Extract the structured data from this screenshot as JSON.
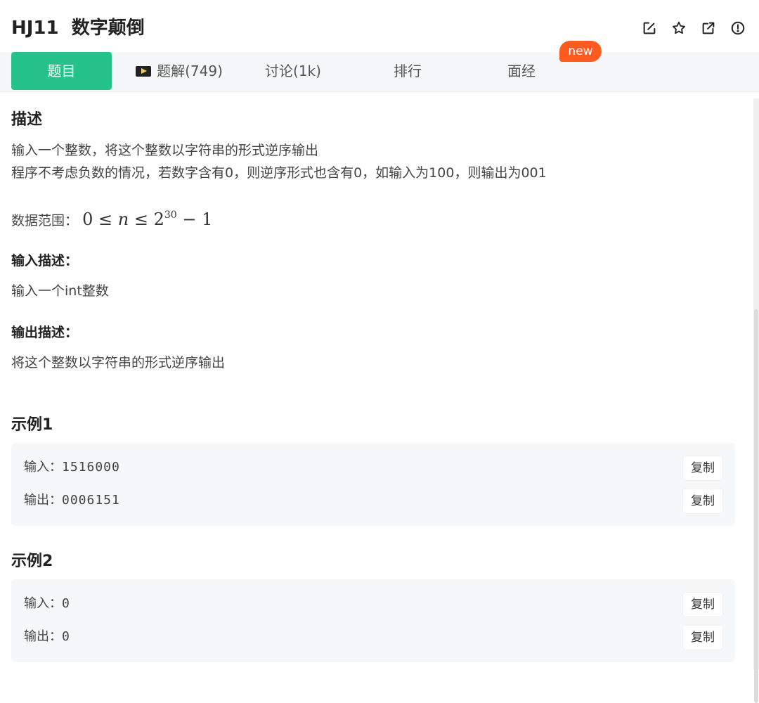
{
  "header": {
    "title": "HJ11  数字颠倒",
    "icons": [
      "edit-icon",
      "star-icon",
      "external-link-icon",
      "alert-icon"
    ]
  },
  "tabs": [
    {
      "label": "题目",
      "active": true
    },
    {
      "label": "题解(749)",
      "icon": "video-icon"
    },
    {
      "label": "讨论(1k)"
    },
    {
      "label": "排行"
    },
    {
      "label": "面经"
    }
  ],
  "badge_new": "new",
  "description": {
    "heading": "描述",
    "line1": "输入一个整数，将这个整数以字符串的形式逆序输出",
    "line2": "程序不考虑负数的情况，若数字含有0，则逆序形式也含有0，如输入为100，则输出为001",
    "range_label": "数据范围：",
    "range_lo": "0",
    "range_leq1": "≤",
    "range_var": "n",
    "range_leq2": "≤",
    "range_base": "2",
    "range_exp": "30",
    "range_minus": "−",
    "range_one": "1"
  },
  "input_desc": {
    "heading": "输入描述：",
    "text": "输入一个int整数"
  },
  "output_desc": {
    "heading": "输出描述：",
    "text": "将这个整数以字符串的形式逆序输出"
  },
  "examples": [
    {
      "heading": "示例1",
      "input_label": "输入：",
      "input": "1516000",
      "output_label": "输出：",
      "output": "0006151",
      "copy": "复制"
    },
    {
      "heading": "示例2",
      "input_label": "输入：",
      "input": "0",
      "output_label": "输出：",
      "output": "0",
      "copy": "复制"
    }
  ],
  "colors": {
    "accent": "#25c38a",
    "badge": "#ff5a1f",
    "panel": "#f6f7f8"
  }
}
